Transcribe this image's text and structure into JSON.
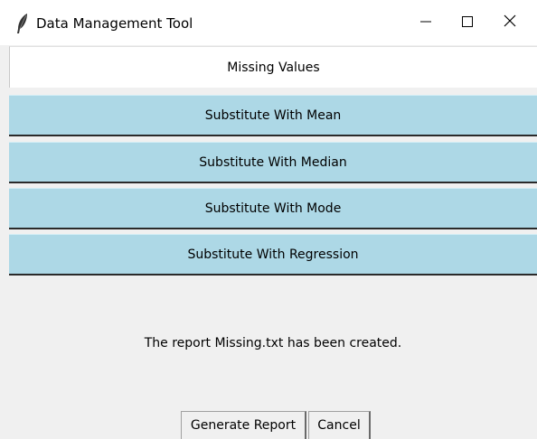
{
  "window": {
    "title": "Data Management Tool",
    "icon": "feather-icon",
    "controls": [
      "minimize-icon",
      "maximize-icon",
      "close-icon"
    ]
  },
  "header": {
    "label": "Missing Values"
  },
  "options": [
    {
      "label": "Substitute With Mean"
    },
    {
      "label": "Substitute With Median"
    },
    {
      "label": "Substitute With Mode"
    },
    {
      "label": "Substitute With Regression"
    }
  ],
  "status": {
    "message": "The report Missing.txt has been created."
  },
  "actions": {
    "generate_label": "Generate Report",
    "cancel_label": "Cancel"
  },
  "colors": {
    "option_background": "#add8e6",
    "window_background": "#f0f0f0",
    "titlebar_background": "#ffffff"
  }
}
